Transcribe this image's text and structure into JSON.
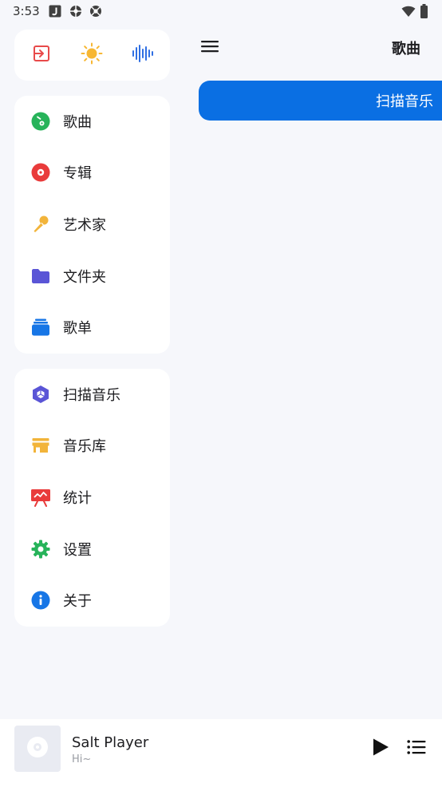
{
  "status_bar": {
    "time": "3:53",
    "left_icons": [
      "app-j-icon",
      "aperture-icon",
      "aperture-icon"
    ],
    "right_icons": [
      "wifi-icon",
      "battery-icon"
    ]
  },
  "drawer": {
    "top_actions": [
      {
        "icon": "exit-icon",
        "color": "#e84a4a"
      },
      {
        "icon": "sun-icon",
        "color": "#f7b733"
      },
      {
        "icon": "waveform-icon",
        "color": "#2f6fe3"
      }
    ],
    "library_items": [
      {
        "label": "歌曲",
        "icon": "music-note-circle-icon",
        "color": "#27b35a"
      },
      {
        "label": "专辑",
        "icon": "album-disc-icon",
        "color": "#e93b3b"
      },
      {
        "label": "艺术家",
        "icon": "microphone-icon",
        "color": "#f2b43a"
      },
      {
        "label": "文件夹",
        "icon": "folder-icon",
        "color": "#5a55d6"
      },
      {
        "label": "歌单",
        "icon": "playlist-stack-icon",
        "color": "#1776e6"
      }
    ],
    "tool_items": [
      {
        "label": "扫描音乐",
        "icon": "scan-cube-icon",
        "color": "#5a55d6"
      },
      {
        "label": "音乐库",
        "icon": "store-icon",
        "color": "#f2b43a"
      },
      {
        "label": "统计",
        "icon": "chart-board-icon",
        "color": "#e93b3b"
      },
      {
        "label": "设置",
        "icon": "gear-icon",
        "color": "#27b35a"
      },
      {
        "label": "关于",
        "icon": "info-icon",
        "color": "#1776e6"
      }
    ]
  },
  "main": {
    "title": "歌曲",
    "scan_button_label": "扫描音乐"
  },
  "mini_player": {
    "title": "Salt Player",
    "subtitle": "Hi~"
  }
}
